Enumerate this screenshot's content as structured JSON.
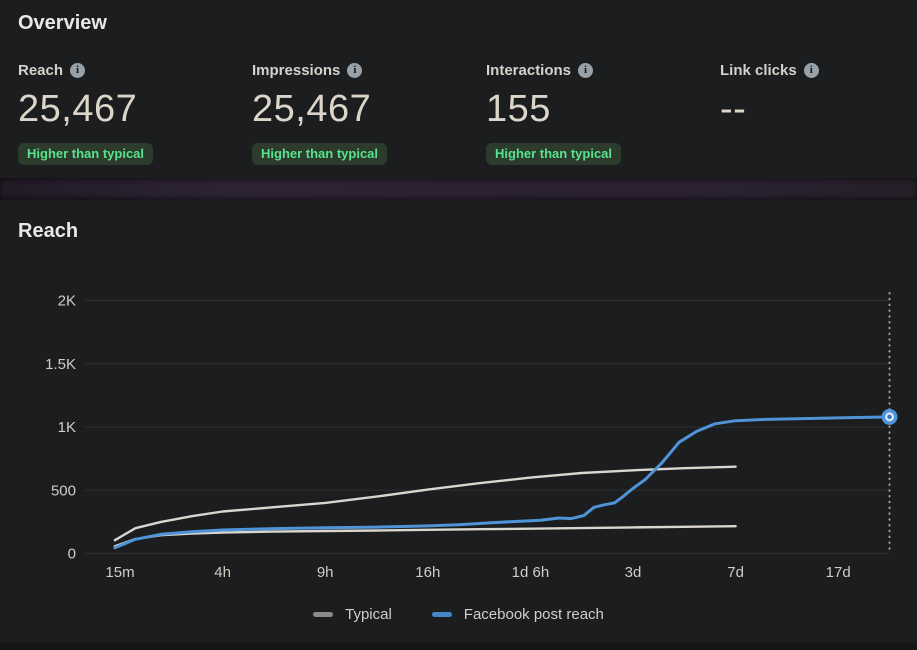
{
  "overview": {
    "title": "Overview",
    "metrics": [
      {
        "label": "Reach",
        "value": "25,467",
        "badge": "Higher than typical"
      },
      {
        "label": "Impressions",
        "value": "25,467",
        "badge": "Higher than typical"
      },
      {
        "label": "Interactions",
        "value": "155",
        "badge": "Higher than typical"
      },
      {
        "label": "Link clicks",
        "value": "--",
        "badge": ""
      }
    ]
  },
  "icons": {
    "info_glyph": "i"
  },
  "reach_section": {
    "title": "Reach"
  },
  "colors": {
    "background": "#1b1d1e",
    "divider_purple": "#2b2133",
    "badge_bg": "#2d3b2c",
    "badge_text": "#57e28c",
    "typical_line": "#d9d5cf",
    "reach_line": "#4f94d8"
  },
  "chart_data": {
    "type": "line",
    "title": "Reach",
    "xlabel": "",
    "ylabel": "",
    "x_tick_labels": [
      "15m",
      "4h",
      "9h",
      "16h",
      "1d 6h",
      "3d",
      "7d",
      "17d"
    ],
    "y_tick_labels": [
      "0",
      "500",
      "1K",
      "1.5K",
      "2K"
    ],
    "y_tick_values": [
      0,
      500,
      1000,
      1500,
      2000
    ],
    "ylim": [
      0,
      2000
    ],
    "grid": "horizontal",
    "x_units": "tick index (0=15m to 7=17d)",
    "cursor_x": 7.5,
    "series": [
      {
        "id": "typical-upper",
        "name": "Typical (upper bound)",
        "color": "#d9d5cf",
        "width": 2.4,
        "points": [
          [
            -0.05,
            105
          ],
          [
            0.15,
            200
          ],
          [
            0.4,
            250
          ],
          [
            0.7,
            295
          ],
          [
            1,
            332
          ],
          [
            1.5,
            366
          ],
          [
            2,
            400
          ],
          [
            2.5,
            450
          ],
          [
            3,
            505
          ],
          [
            3.5,
            556
          ],
          [
            4,
            600
          ],
          [
            4.5,
            636
          ],
          [
            5,
            658
          ],
          [
            5.5,
            674
          ],
          [
            6,
            686
          ]
        ]
      },
      {
        "id": "typical-lower",
        "name": "Typical (lower bound)",
        "color": "#d9d5cf",
        "width": 2.4,
        "points": [
          [
            -0.05,
            58
          ],
          [
            0.15,
            115
          ],
          [
            0.4,
            145
          ],
          [
            0.7,
            158
          ],
          [
            1,
            166
          ],
          [
            1.5,
            173
          ],
          [
            2,
            178
          ],
          [
            2.5,
            182
          ],
          [
            3,
            187
          ],
          [
            3.5,
            192
          ],
          [
            4,
            196
          ],
          [
            4.5,
            201
          ],
          [
            5,
            206
          ],
          [
            5.5,
            211
          ],
          [
            6,
            216
          ]
        ]
      },
      {
        "id": "facebook-post-reach",
        "name": "Facebook post reach",
        "color": "#4f94d8",
        "width": 3,
        "points": [
          [
            -0.05,
            45
          ],
          [
            0.15,
            112
          ],
          [
            0.4,
            152
          ],
          [
            0.7,
            172
          ],
          [
            1,
            186
          ],
          [
            1.5,
            197
          ],
          [
            2,
            203
          ],
          [
            2.5,
            209
          ],
          [
            3,
            218
          ],
          [
            3.3,
            228
          ],
          [
            3.6,
            242
          ],
          [
            3.9,
            255
          ],
          [
            4.1,
            263
          ],
          [
            4.28,
            281
          ],
          [
            4.4,
            276
          ],
          [
            4.52,
            300
          ],
          [
            4.62,
            365
          ],
          [
            4.72,
            385
          ],
          [
            4.82,
            400
          ],
          [
            4.9,
            448
          ],
          [
            5,
            515
          ],
          [
            5.12,
            585
          ],
          [
            5.28,
            715
          ],
          [
            5.45,
            880
          ],
          [
            5.62,
            965
          ],
          [
            5.8,
            1025
          ],
          [
            6,
            1050
          ],
          [
            6.3,
            1060
          ],
          [
            6.6,
            1066
          ],
          [
            7,
            1072
          ],
          [
            7.5,
            1080
          ]
        ]
      }
    ],
    "endpoint_marker": {
      "series": "facebook-post-reach",
      "x": 7.5,
      "value": 1080,
      "colors": [
        "#4f94d8",
        "#d9e8f6",
        "#2f74bd"
      ]
    },
    "legend_position": "bottom",
    "legend": [
      {
        "label": "Typical",
        "color": "#8b8b8b"
      },
      {
        "label": "Facebook post reach",
        "color": "#4486ca"
      }
    ]
  }
}
